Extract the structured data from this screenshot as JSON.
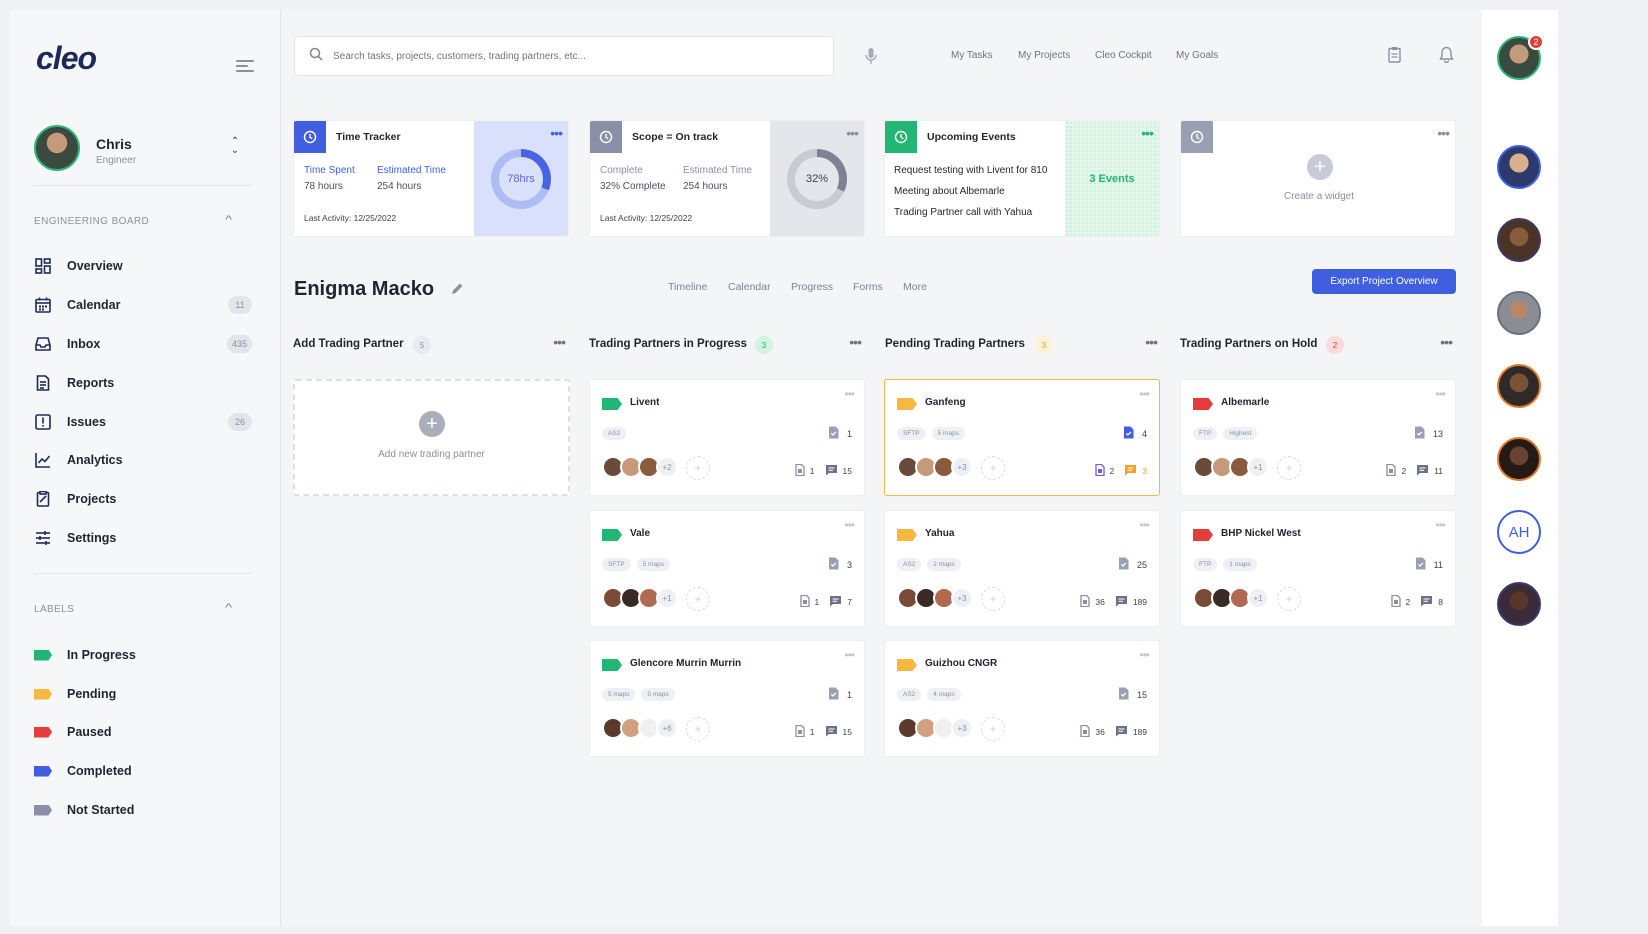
{
  "app": {
    "logo": "cleo"
  },
  "profile": {
    "name": "Chris",
    "role": "Engineer"
  },
  "sidebar": {
    "board_label": "ENGINEERING BOARD",
    "items": [
      {
        "label": "Overview",
        "icon": "grid-icon",
        "count": ""
      },
      {
        "label": "Calendar",
        "icon": "calendar-icon",
        "count": "11"
      },
      {
        "label": "Inbox",
        "icon": "inbox-icon",
        "count": "435"
      },
      {
        "label": "Reports",
        "icon": "document-icon",
        "count": ""
      },
      {
        "label": "Issues",
        "icon": "alert-icon",
        "count": "26"
      },
      {
        "label": "Analytics",
        "icon": "chart-line-icon",
        "count": ""
      },
      {
        "label": "Projects",
        "icon": "clipboard-icon",
        "count": ""
      },
      {
        "label": "Settings",
        "icon": "sliders-icon",
        "count": ""
      }
    ],
    "labels_label": "LABELS",
    "labels": [
      {
        "label": "In Progress",
        "color": "#22b573"
      },
      {
        "label": "Pending",
        "color": "#f5b942"
      },
      {
        "label": "Paused",
        "color": "#e53c3c"
      },
      {
        "label": "Completed",
        "color": "#3f5fe0"
      },
      {
        "label": "Not Started",
        "color": "#8a90a8"
      }
    ]
  },
  "topbar": {
    "search_placeholder": "Search tasks, projects, customers, trading partners, etc...",
    "nav": [
      "My Tasks",
      "My Projects",
      "Cleo Cockpit",
      "My Goals"
    ]
  },
  "widgets": {
    "time_tracker": {
      "title": "Time Tracker",
      "l1": "Time Spent",
      "v1": "78 hours",
      "l2": "Estimated Time",
      "v2": "254 hours",
      "activity": "Last Activity: 12/25/2022",
      "donut": "78hrs",
      "progress": 0.31
    },
    "scope": {
      "title": "Scope = On track",
      "l1": "Complete",
      "v1": "32% Complete",
      "l2": "Estimated Time",
      "v2": "254 hours",
      "activity": "Last Activity: 12/25/2022",
      "donut": "32%",
      "progress": 0.32
    },
    "events": {
      "title": "Upcoming Events",
      "items": [
        "Request testing with Livent for 810",
        "Meeting  about Albemarle",
        "Trading Partner call with Yahua"
      ],
      "summary": "3 Events"
    },
    "create": {
      "label": "Create a widget"
    }
  },
  "project": {
    "title": "Enigma Macko",
    "tabs": [
      "Timeline",
      "Calendar",
      "Progress",
      "Forms",
      "More"
    ],
    "export_label": "Export Project Overview"
  },
  "columns": [
    {
      "title": "Add Trading Partner",
      "count": "5",
      "add_label": "Add new trading partner"
    },
    {
      "title": "Trading Partners in Progress",
      "count": "3"
    },
    {
      "title": "Pending Trading Partners",
      "count": "3"
    },
    {
      "title": "Trading Partners on Hold",
      "count": "2"
    }
  ],
  "cards": [
    {
      "name": "Livent",
      "pills": [
        "AS2"
      ],
      "docs": "1",
      "more": "+2",
      "files": "1",
      "comments": "15",
      "color": "#22b573"
    },
    {
      "name": "Vale",
      "pills": [
        "SFTP",
        "5 maps"
      ],
      "docs": "3",
      "more": "+1",
      "files": "1",
      "comments": "7",
      "color": "#22b573"
    },
    {
      "name": "Glencore Murrin Murrin",
      "pills": [
        "5 maps",
        "5 maps"
      ],
      "docs": "1",
      "more": "+6",
      "files": "1",
      "comments": "15",
      "color": "#22b573"
    },
    {
      "name": "Ganfeng",
      "pills": [
        "SFTP",
        "5 maps"
      ],
      "docs": "4",
      "more": "+3",
      "files": "2",
      "comments": "3",
      "color": "#f5b942"
    },
    {
      "name": "Yahua",
      "pills": [
        "AS2",
        "2 maps"
      ],
      "docs": "25",
      "more": "+3",
      "files": "36",
      "comments": "189",
      "color": "#f5b942"
    },
    {
      "name": "Guizhou CNGR",
      "pills": [
        "AS2",
        "4 maps"
      ],
      "docs": "15",
      "more": "+3",
      "files": "36",
      "comments": "189",
      "color": "#f5b942"
    },
    {
      "name": "Albemarle",
      "pills": [
        "FTP",
        "Highest"
      ],
      "docs": "13",
      "more": "+1",
      "files": "2",
      "comments": "11",
      "color": "#e53c3c"
    },
    {
      "name": "BHP Nickel West",
      "pills": [
        "FTP",
        "1 maps"
      ],
      "docs": "11",
      "more": "+1",
      "files": "2",
      "comments": "8",
      "color": "#e53c3c"
    }
  ],
  "rail": {
    "notification_count": "2",
    "initials": "AH"
  },
  "colors": {
    "accent": "#3f5fe0",
    "green": "#22b573",
    "yellow": "#f5b942",
    "red": "#e53c3c"
  }
}
